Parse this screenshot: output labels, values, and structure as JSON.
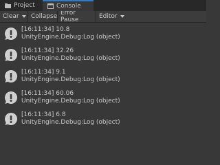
{
  "tabs": {
    "project": "Project",
    "console": "Console"
  },
  "toolbar": {
    "clear": "Clear",
    "collapse": "Collapse",
    "error_pause": "Error Pause",
    "editor": "Editor"
  },
  "logs": [
    {
      "line1": "[16:11:34] 10.8",
      "line2": "UnityEngine.Debug:Log (object)"
    },
    {
      "line1": "[16:11:34] 32.26",
      "line2": "UnityEngine.Debug:Log (object)"
    },
    {
      "line1": "[16:11:34] 9.1",
      "line2": "UnityEngine.Debug:Log (object)"
    },
    {
      "line1": "[16:11:34] 60.06",
      "line2": "UnityEngine.Debug:Log (object)"
    },
    {
      "line1": "[16:11:34] 6.8",
      "line2": "UnityEngine.Debug:Log (object)"
    }
  ],
  "icons": {
    "project_tab": "folder-icon",
    "console_tab": "console-icon",
    "log": "info-bubble-icon"
  },
  "colors": {
    "background": "#383838",
    "tabbar": "#282828",
    "active_tab_accent": "#3a79bb",
    "icon": "#cfcfcf"
  }
}
